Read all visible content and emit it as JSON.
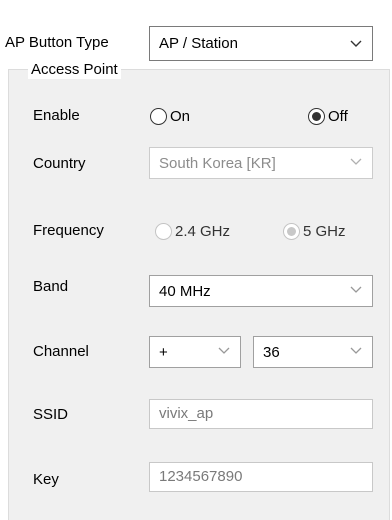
{
  "ap_button_type": {
    "label": "AP Button Type",
    "value": "AP / Station"
  },
  "access_point": {
    "group_title": "Access Point",
    "enable": {
      "label": "Enable",
      "options": [
        "On",
        "Off"
      ],
      "selected": "Off"
    },
    "country": {
      "label": "Country",
      "value": "South Korea [KR]"
    },
    "frequency": {
      "label": "Frequency",
      "options": [
        "2.4 GHz",
        "5 GHz"
      ],
      "selected": "5 GHz"
    },
    "band": {
      "label": "Band",
      "value": "40 MHz"
    },
    "channel": {
      "label": "Channel",
      "offset_value": "+",
      "channel_value": "36"
    },
    "ssid": {
      "label": "SSID",
      "value": "vivix_ap"
    },
    "key": {
      "label": "Key",
      "value": "1234567890"
    }
  }
}
